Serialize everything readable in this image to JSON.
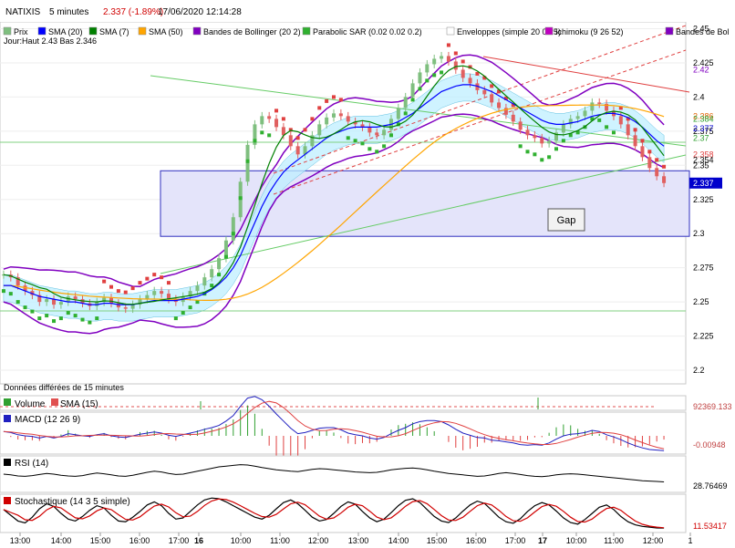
{
  "header": {
    "symbol": "NATIXIS",
    "interval": "5 minutes",
    "price": "2.337 (-1.89%)",
    "datetime": "17/06/2020 12:14:28"
  },
  "legend": {
    "items": [
      {
        "label": "Prix",
        "color": "#7fbf7f"
      },
      {
        "label": "SMA (20)",
        "color": "#0000ff"
      },
      {
        "label": "SMA (7)",
        "color": "#008000"
      },
      {
        "label": "SMA (50)",
        "color": "#ffa500"
      },
      {
        "label": "Bandes de Bollinger (20 2)",
        "color": "#8000c0"
      },
      {
        "label": "Parabolic SAR (0.02 0.02 0.2)",
        "color": "#30b030"
      },
      {
        "label": "Enveloppes (simple 20 0.25)",
        "color": "#ffffff"
      },
      {
        "label": "Ichimoku (9 26 52)",
        "color": "#c000c0"
      },
      {
        "label": "Bandes de Bol",
        "color": "#8000c0"
      }
    ],
    "jour_text": "Jour:Haut 2.43 Bas 2.346"
  },
  "annotations": {
    "gap_label": "Gap",
    "delay_note": "Données différées de 15 minutes"
  },
  "panels": {
    "volume": {
      "label": "Volume",
      "sma_label": "SMA (15)",
      "value": "92369.133"
    },
    "macd": {
      "label": "MACD (12 26 9)",
      "value": "-0.00948"
    },
    "rsi": {
      "label": "RSI (14)",
      "value": "28.76469"
    },
    "stoch": {
      "label": "Stochastique (14 3 5 simple)",
      "value": "11.53417"
    }
  },
  "colors": {
    "candle_up": "#7fbf7f",
    "candle_down": "#e06060",
    "sma20": "#0000ff",
    "sma7": "#008000",
    "sma50": "#ffa500",
    "bollinger": "#8000c0",
    "sar_up": "#30b030",
    "sar_down": "#e04040",
    "cloud_fill": "#bfefff",
    "gap_fill": "#e4e4fa",
    "gap_border": "#3030c0",
    "price_tag": "#0000cc"
  },
  "chart_data": {
    "type": "candlestick",
    "title": "NATIXIS",
    "ylim": [
      2.19,
      2.455
    ],
    "y_ticks": [
      "2.45",
      "2.425",
      "2.4",
      "2.375",
      "2.35",
      "2.325",
      "2.3",
      "2.275",
      "2.25",
      "2.225",
      "2.2"
    ],
    "x_ticks": [
      "13:00",
      "14:00",
      "15:00",
      "16:00",
      "17:00",
      "16",
      "10:00",
      "11:00",
      "12:00",
      "13:00",
      "14:00",
      "15:00",
      "16:00",
      "17:00",
      "17",
      "10:00",
      "11:00",
      "12:00",
      "1"
    ],
    "right_labels": [
      "2.42",
      "2.386",
      "2.384",
      "2.377",
      "2.37",
      "2.358",
      "2.354",
      "2.337"
    ],
    "horizontal_levels": [
      2.37,
      2.25
    ],
    "gap_zone": [
      2.298,
      2.346
    ],
    "close": [
      2.27,
      2.268,
      2.262,
      2.258,
      2.255,
      2.25,
      2.252,
      2.248,
      2.25,
      2.254,
      2.252,
      2.249,
      2.247,
      2.25,
      2.253,
      2.249,
      2.246,
      2.245,
      2.248,
      2.252,
      2.255,
      2.258,
      2.256,
      2.252,
      2.25,
      2.254,
      2.258,
      2.262,
      2.268,
      2.274,
      2.282,
      2.295,
      2.312,
      2.338,
      2.365,
      2.38,
      2.386,
      2.384,
      2.378,
      2.372,
      2.364,
      2.358,
      2.364,
      2.372,
      2.38,
      2.385,
      2.388,
      2.386,
      2.382,
      2.38,
      2.378,
      2.374,
      2.372,
      2.376,
      2.384,
      2.392,
      2.4,
      2.41,
      2.418,
      2.424,
      2.428,
      2.43,
      2.426,
      2.42,
      2.414,
      2.41,
      2.405,
      2.402,
      2.396,
      2.392,
      2.387,
      2.382,
      2.376,
      2.372,
      2.37,
      2.366,
      2.368,
      2.374,
      2.38,
      2.384,
      2.386,
      2.39,
      2.396,
      2.395,
      2.39,
      2.386,
      2.38,
      2.372,
      2.364,
      2.356,
      2.348,
      2.342,
      2.337
    ],
    "sma20": [
      2.262,
      2.262,
      2.26,
      2.258,
      2.256,
      2.254,
      2.253,
      2.252,
      2.251,
      2.25,
      2.25,
      2.249,
      2.248,
      2.248,
      2.249,
      2.249,
      2.248,
      2.248,
      2.248,
      2.249,
      2.25,
      2.251,
      2.251,
      2.251,
      2.251,
      2.252,
      2.253,
      2.254,
      2.256,
      2.259,
      2.263,
      2.268,
      2.275,
      2.284,
      2.296,
      2.308,
      2.32,
      2.33,
      2.338,
      2.345,
      2.35,
      2.354,
      2.358,
      2.362,
      2.366,
      2.37,
      2.373,
      2.375,
      2.377,
      2.378,
      2.378,
      2.378,
      2.378,
      2.379,
      2.38,
      2.382,
      2.385,
      2.388,
      2.392,
      2.396,
      2.4,
      2.404,
      2.406,
      2.408,
      2.409,
      2.409,
      2.408,
      2.406,
      2.404,
      2.401,
      2.398,
      2.395,
      2.392,
      2.389,
      2.386,
      2.383,
      2.381,
      2.38,
      2.38,
      2.381,
      2.382,
      2.384,
      2.386,
      2.387,
      2.388,
      2.388,
      2.387,
      2.385,
      2.382,
      2.378,
      2.373,
      2.368,
      2.364
    ],
    "stoch_k": [
      60,
      45,
      30,
      25,
      40,
      62,
      75,
      68,
      50,
      35,
      30,
      42,
      58,
      70,
      64,
      45,
      30,
      28,
      40,
      55,
      72,
      80,
      70,
      50,
      35,
      38,
      55,
      72,
      85,
      90,
      88,
      80,
      70,
      60,
      50,
      40,
      35,
      45,
      62,
      78,
      85,
      75,
      58,
      40,
      30,
      34,
      50,
      68,
      80,
      74,
      55,
      38,
      28,
      35,
      52,
      70,
      84,
      88,
      78,
      60,
      42,
      30,
      26,
      38,
      56,
      72,
      82,
      76,
      58,
      40,
      28,
      24,
      36,
      55,
      70,
      78,
      72,
      56,
      38,
      26,
      22,
      34,
      50,
      66,
      72,
      60,
      42,
      28,
      20,
      16,
      14,
      12,
      11.5
    ],
    "rsi": [
      50,
      48,
      45,
      44,
      46,
      49,
      52,
      50,
      47,
      45,
      44,
      46,
      50,
      53,
      51,
      48,
      45,
      44,
      47,
      51,
      55,
      58,
      56,
      52,
      49,
      50,
      54,
      58,
      62,
      66,
      70,
      72,
      74,
      76,
      75,
      72,
      68,
      65,
      62,
      60,
      58,
      57,
      60,
      63,
      65,
      64,
      62,
      60,
      58,
      56,
      55,
      54,
      55,
      58,
      62,
      64,
      66,
      67,
      65,
      62,
      58,
      55,
      52,
      50,
      48,
      46,
      44,
      45,
      48,
      52,
      54,
      52,
      49,
      46,
      44,
      43,
      45,
      48,
      50,
      51,
      50,
      48,
      46,
      44,
      42,
      40,
      38,
      36,
      34,
      32,
      31,
      30,
      28.8
    ]
  }
}
